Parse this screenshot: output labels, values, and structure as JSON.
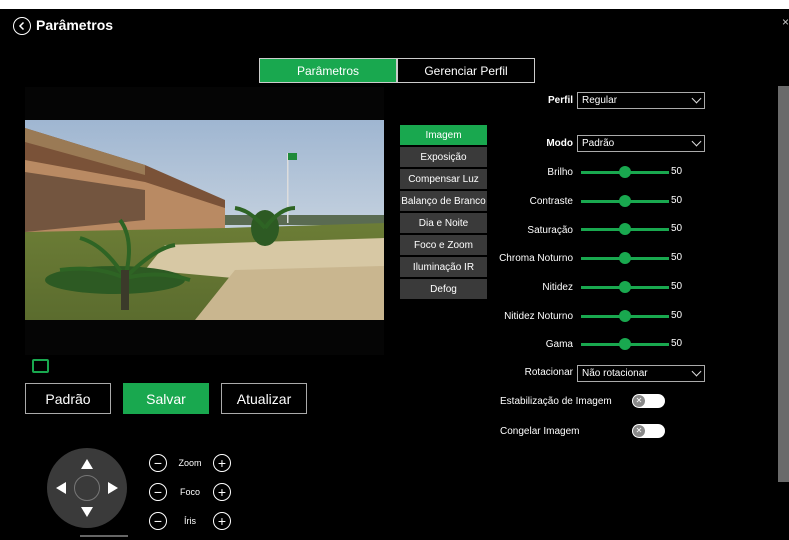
{
  "header": {
    "title": "Parâmetros",
    "close": "×"
  },
  "tabs": [
    {
      "label": "Parâmetros",
      "active": true
    },
    {
      "label": "Gerenciar Perfil",
      "active": false
    }
  ],
  "actions": {
    "default_label": "Padrão",
    "save_label": "Salvar",
    "refresh_label": "Atualizar"
  },
  "lens": {
    "zoom": {
      "label": "Zoom",
      "minus": "−",
      "plus": "+"
    },
    "focus": {
      "label": "Foco",
      "minus": "−",
      "plus": "+"
    },
    "iris": {
      "label": "Íris",
      "minus": "−",
      "plus": "+"
    }
  },
  "categories": [
    {
      "label": "Imagem",
      "active": true
    },
    {
      "label": "Exposição",
      "active": false
    },
    {
      "label": "Compensar Luz",
      "active": false
    },
    {
      "label": "Balanço de Branco",
      "active": false
    },
    {
      "label": "Dia e Noite",
      "active": false
    },
    {
      "label": "Foco e Zoom",
      "active": false
    },
    {
      "label": "Iluminação IR",
      "active": false
    },
    {
      "label": "Defog",
      "active": false
    }
  ],
  "settings": {
    "profile": {
      "label": "Perfil",
      "value": "Regular"
    },
    "mode": {
      "label": "Modo",
      "value": "Padrão"
    },
    "sliders": [
      {
        "label": "Brilho",
        "value": 50,
        "display": "50"
      },
      {
        "label": "Contraste",
        "value": 50,
        "display": "50"
      },
      {
        "label": "Saturação",
        "value": 50,
        "display": "50"
      },
      {
        "label": "Chroma Noturno",
        "value": 50,
        "display": "50"
      },
      {
        "label": "Nitidez",
        "value": 50,
        "display": "50"
      },
      {
        "label": "Nitidez Noturno",
        "value": 50,
        "display": "50"
      },
      {
        "label": "Gama",
        "value": 50,
        "display": "50"
      }
    ],
    "rotate": {
      "label": "Rotacionar",
      "value": "Não rotacionar"
    },
    "stabilization": {
      "label": "Estabilização de Imagem",
      "enabled": false,
      "knob": "✕"
    },
    "freeze": {
      "label": "Congelar Imagem",
      "enabled": false,
      "knob": "✕"
    }
  },
  "colors": {
    "accent": "#19a84f",
    "background": "#000000",
    "panel": "#3a3a3a"
  }
}
